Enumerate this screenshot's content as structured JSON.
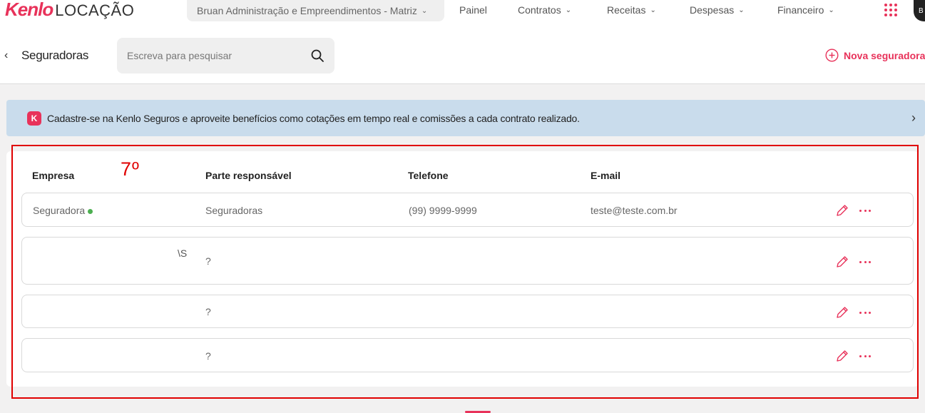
{
  "app": {
    "brand": "Kenlo",
    "product": "LOCAÇÃO",
    "company_selector": "Bruan Administração e Empreendimentos - Matriz",
    "avatar_initial": "B"
  },
  "nav": {
    "painel": "Painel",
    "contratos": "Contratos",
    "receitas": "Receitas",
    "despesas": "Despesas",
    "financeiro": "Financeiro"
  },
  "header": {
    "title": "Seguradoras",
    "search_placeholder": "Escreva para pesquisar",
    "search_value": "",
    "new_button": "Nova seguradora"
  },
  "banner": {
    "icon_letter": "K",
    "text": "Cadastre-se na Kenlo Seguros e aproveite benefícios como cotações em tempo real e comissões a cada contrato realizado."
  },
  "annotation": "7º",
  "table": {
    "columns": {
      "empresa": "Empresa",
      "parte": "Parte responsável",
      "telefone": "Telefone",
      "email": "E-mail"
    },
    "rows": [
      {
        "empresa": "Seguradora",
        "status": "active",
        "extra": "",
        "parte": "Seguradoras",
        "telefone": "(99) 9999-9999",
        "email": "teste@teste.com.br"
      },
      {
        "empresa": "",
        "status": "",
        "extra": "\\S",
        "parte": "?",
        "telefone": "",
        "email": ""
      },
      {
        "empresa": "",
        "status": "",
        "extra": "",
        "parte": "?",
        "telefone": "",
        "email": ""
      },
      {
        "empresa": "",
        "status": "",
        "extra": "",
        "parte": "?",
        "telefone": "",
        "email": ""
      }
    ]
  },
  "colors": {
    "accent": "#e8325a",
    "banner_bg": "#c9dcec",
    "status_active": "#4caf50",
    "annotation": "#e00000"
  }
}
